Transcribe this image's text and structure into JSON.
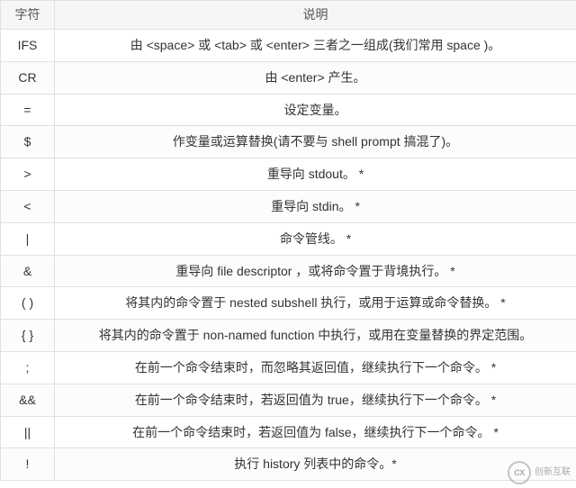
{
  "table": {
    "headers": {
      "col1": "字符",
      "col2": "说明"
    },
    "rows": [
      {
        "sym": "IFS",
        "desc": "由 <space> 或 <tab> 或 <enter> 三者之一组成(我们常用 space )。"
      },
      {
        "sym": "CR",
        "desc": "由 <enter> 产生。"
      },
      {
        "sym": "=",
        "desc": "设定变量。"
      },
      {
        "sym": "$",
        "desc": "作变量或运算替换(请不要与 shell prompt 搞混了)。"
      },
      {
        "sym": ">",
        "desc": "重导向 stdout。 *"
      },
      {
        "sym": "<",
        "desc": "重导向 stdin。 *"
      },
      {
        "sym": "|",
        "desc": "命令管线。 *"
      },
      {
        "sym": "&",
        "desc": "重导向 file descriptor ，或将命令置于背境执行。 *"
      },
      {
        "sym": "( )",
        "desc": "将其内的命令置于 nested subshell 执行，或用于运算或命令替换。 *"
      },
      {
        "sym": "{ }",
        "desc": "将其内的命令置于 non-named function 中执行，或用在变量替换的界定范围。"
      },
      {
        "sym": ";",
        "desc": "在前一个命令结束时，而忽略其返回值，继续执行下一个命令。 *"
      },
      {
        "sym": "&&",
        "desc": "在前一个命令结束时，若返回值为 true，继续执行下一个命令。 *"
      },
      {
        "sym": "||",
        "desc": "在前一个命令结束时，若返回值为 false，继续执行下一个命令。 *"
      },
      {
        "sym": "!",
        "desc": "执行 history 列表中的命令。*"
      }
    ]
  },
  "watermark": {
    "logo_text": "CX",
    "label": "创新互联"
  }
}
